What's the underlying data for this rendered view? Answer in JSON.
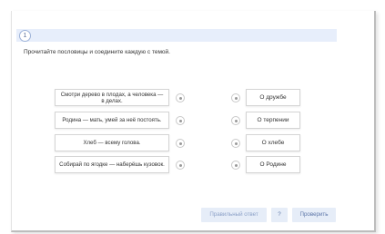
{
  "question": {
    "number": "1",
    "prompt": "Прочитайте пословицы и соедините каждую с темой."
  },
  "proverbs": [
    "Смотри дерево в плодах, а человека — в делах.",
    "Родина — мать, умей за неё постоять.",
    "Хлеб — всему голова.",
    "Собирай по ягодке — наберёшь кузовок."
  ],
  "themes": [
    "О дружбе",
    "О терпении",
    "О хлебе",
    "О Родине"
  ],
  "buttons": {
    "correct_answer": "Правильный ответ",
    "help": "?",
    "check": "Проверить"
  }
}
